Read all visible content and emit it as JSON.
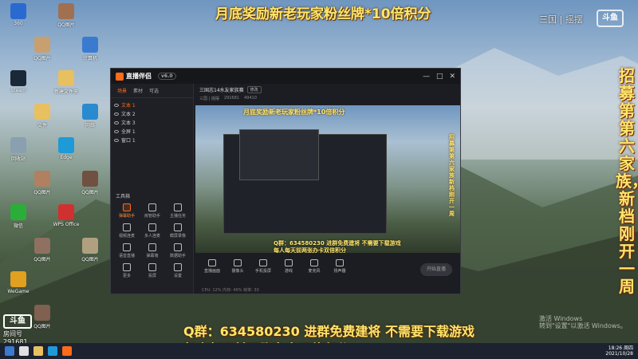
{
  "banner_top": "月底奖励新老玩家粉丝牌*10倍积分",
  "vertical_banner": "招募第第六家族，新档刚开一周",
  "bottom_line_1": "Q群：634580230 进群免费建将 不需要下载游戏",
  "bottom_line_2": "每人每天前两张办卡双倍积分",
  "douyu_overlay": "三国 | 摇摆",
  "douyu_logo": "斗鱼",
  "room": {
    "logo": "斗鱼",
    "name": "房间号",
    "id": "291681"
  },
  "windows_watermark": [
    "激活 Windows",
    "转到\"设置\"以激活 Windows。"
  ],
  "desktop_icons": [
    {
      "label": "360",
      "color": "#2a6ad0"
    },
    {
      "label": "QQ图片",
      "color": "#c8a070"
    },
    {
      "label": "QQ图片",
      "color": "#a07050"
    },
    {
      "label": "计算机",
      "color": "#3a7bd0"
    },
    {
      "label": "Steam",
      "color": "#1b2838"
    },
    {
      "label": "文件",
      "color": "#e8c060"
    },
    {
      "label": "新建文件夹",
      "color": "#e8c060"
    },
    {
      "label": "网络",
      "color": "#2a8ad0"
    },
    {
      "label": "回收站",
      "color": "#8aa0b0"
    },
    {
      "label": "QQ图片",
      "color": "#b08060"
    },
    {
      "label": "Edge",
      "color": "#1e9ad6"
    },
    {
      "label": "QQ图片",
      "color": "#705040"
    },
    {
      "label": "微信",
      "color": "#2aae3a"
    },
    {
      "label": "QQ图片",
      "color": "#907060"
    },
    {
      "label": "WPS Office",
      "color": "#d03030"
    },
    {
      "label": "QQ图片",
      "color": "#b0a080"
    },
    {
      "label": "WeGame",
      "color": "#e0a020"
    },
    {
      "label": "QQ图片",
      "color": "#806050"
    }
  ],
  "app": {
    "logo": "直播伴侣",
    "version": "v6.0",
    "side_tabs": [
      "场景",
      "素材",
      "可选"
    ],
    "scenes": [
      "文本 1",
      "文本 2",
      "文本 3",
      "全屏 1",
      "窗口 1"
    ],
    "tools_heading": "工具箱",
    "tools": [
      "弹幕助手",
      "房管助手",
      "主播任务",
      "视频连麦",
      "多人连麦",
      "截屏录像",
      "语音直播",
      "弹幕墙",
      "数据助手",
      "更多",
      "投屏",
      "设置"
    ],
    "room_title": "三国志14水友家族赛",
    "room_btn": "修改",
    "room_meta": [
      "三国 | 摇摆",
      "291681",
      "49410"
    ],
    "preview_banner": "月底奖励新老玩家粉丝牌*10倍积分",
    "preview_q1": "Q群：634580230 进群免费建将 不需要下载游戏",
    "preview_q2": "每人每天前两张办卡双倍积分",
    "preview_vert": "招募第第六家族新档刚开一周",
    "toolbar": [
      "直播画面",
      "摄像头",
      "手机投屏",
      "游戏",
      "麦克风",
      "扬声器"
    ],
    "start_label": "开始直播",
    "status": "CPU: 12%   内存: 46%   帧率: 30"
  },
  "clock": {
    "time": "18:26 周四",
    "date": "2021/10/28"
  }
}
